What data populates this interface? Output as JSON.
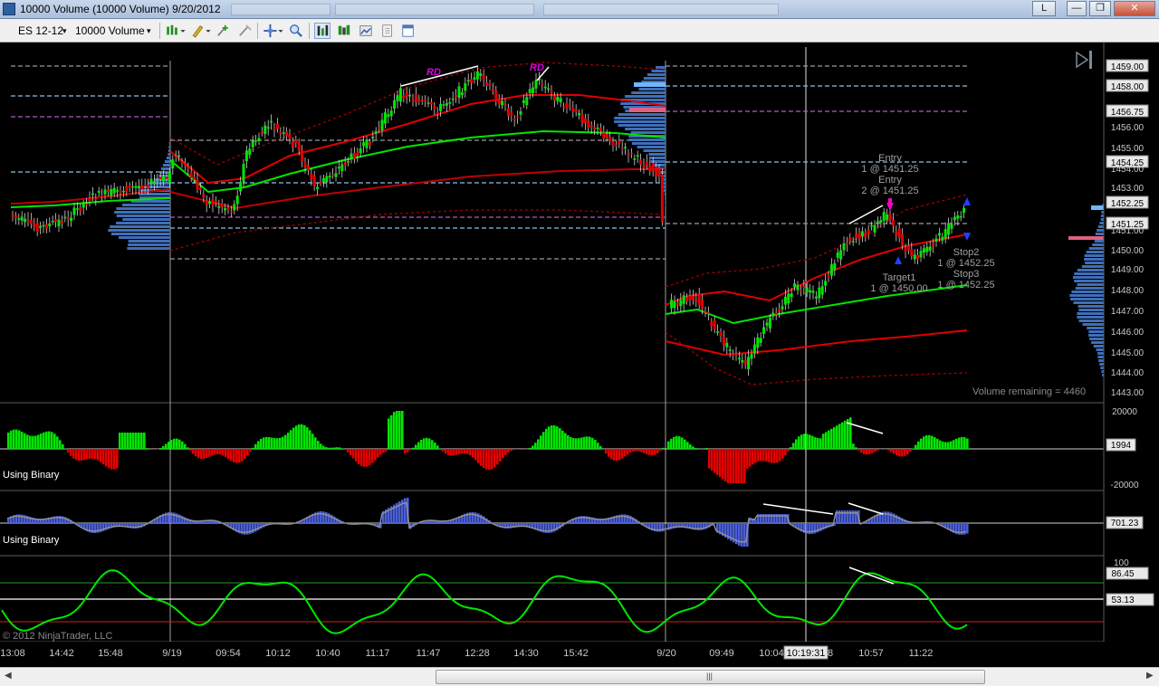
{
  "window": {
    "title": "10000 Volume (10000 Volume)  9/20/2012",
    "link_button": "L",
    "minimize": "—",
    "restore": "❐",
    "close": "✕"
  },
  "toolbar": {
    "instrument": "ES 12-12",
    "period": "10000 Volume",
    "dropdown_arrow": "▾"
  },
  "price_panel": {
    "price_labels": [
      "1459.00",
      "1458.00",
      "1456.75",
      "1456.00",
      "1455.00",
      "1454.25",
      "1454.00",
      "1453.00",
      "1452.25",
      "1451.25",
      "1451.00",
      "1450.00",
      "1449.00",
      "1448.00",
      "1447.00",
      "1446.00",
      "1445.00",
      "1444.00",
      "1443.00"
    ],
    "divergence_labels": [
      "RD",
      "RD"
    ],
    "order_labels": {
      "entry1_title": "Entry",
      "entry1_detail": "1 @ 1451.25",
      "entry2_title": "Entry",
      "entry2_detail": "2 @ 1451.25",
      "stop2_title": "Stop2",
      "stop2_detail": "1 @ 1452.25",
      "stop3_title": "Stop3",
      "stop3_detail": "1 @ 1452.25",
      "target1_title": "Target1",
      "target1_detail": "1 @ 1450.00"
    },
    "volume_remaining": "Volume remaining = 4460"
  },
  "indicator1": {
    "label": "Using Binary",
    "axis": [
      "20000",
      "-20000"
    ],
    "value": "1994"
  },
  "indicator2": {
    "label": "Using Binary",
    "value": "701.23"
  },
  "indicator3": {
    "axis": [
      "100"
    ],
    "value_high": "86.45",
    "value_mid": "53.13"
  },
  "copyright": "© 2012 NinjaTrader, LLC",
  "time_axis": [
    "13:08",
    "14:42",
    "15:48",
    "9/19",
    "09:54",
    "10:12",
    "10:40",
    "11:17",
    "11:47",
    "12:28",
    "14:30",
    "15:42",
    "9/20",
    "09:49",
    "10:04",
    "10:19:31",
    "8",
    "10:57",
    "11:22"
  ],
  "crosshair_time": "10:19:31",
  "colors": {
    "up_candle": "#00e600",
    "down_candle": "#e60000",
    "green_line": "#00e600",
    "red_line": "#e00000",
    "profile_blue": "#3f6fb8",
    "profile_light": "#6fb6ff",
    "blue_hist": "#4a5ed8",
    "magenta_label": "#e000e0"
  }
}
